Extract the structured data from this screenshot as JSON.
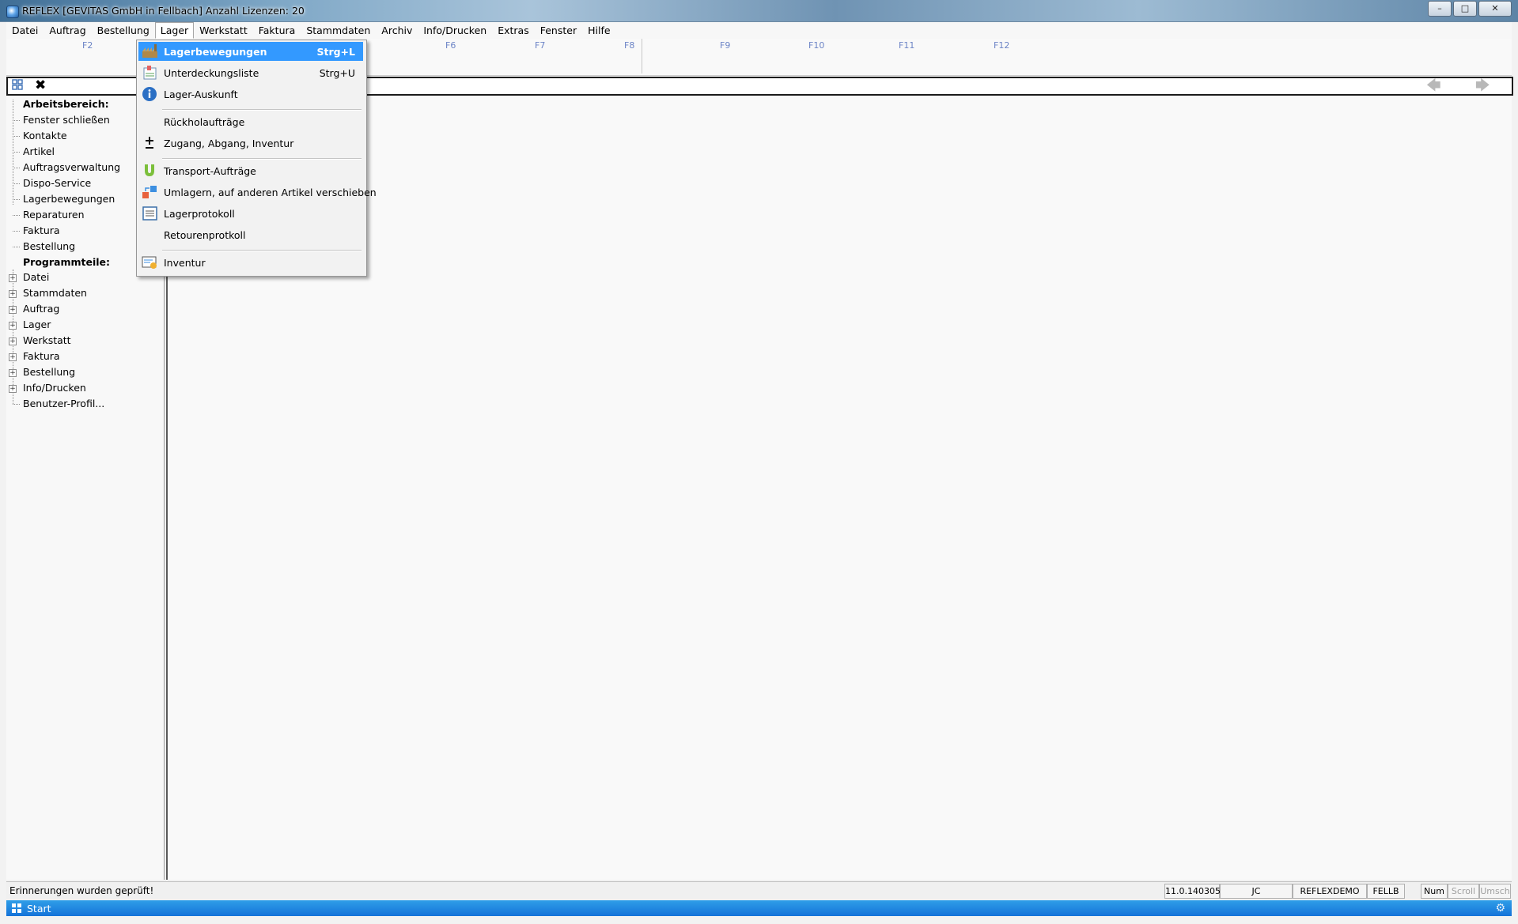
{
  "window": {
    "title": "REFLEX [GEVITAS GmbH in Fellbach] Anzahl Lizenzen: 20",
    "controls": [
      "minimize",
      "maximize",
      "close"
    ]
  },
  "menubar": {
    "items": [
      "Datei",
      "Auftrag",
      "Bestellung",
      "Lager",
      "Werkstatt",
      "Faktura",
      "Stammdaten",
      "Archiv",
      "Info/Drucken",
      "Extras",
      "Fenster",
      "Hilfe"
    ],
    "active": "Lager"
  },
  "fkeys": [
    "F2",
    "F6",
    "F7",
    "F8",
    "F9",
    "F10",
    "F11",
    "F12"
  ],
  "toolbar": {
    "icons": [
      "grid-icon",
      "close-x-icon",
      "arrow-left-icon",
      "arrow-right-icon"
    ]
  },
  "sidebar": {
    "workspace_header": "Arbeitsbereich:",
    "workspace_items": [
      "Fenster schließen",
      "Kontakte",
      "Artikel",
      "Auftragsverwaltung",
      "Dispo-Service",
      "Lagerbewegungen",
      "Reparaturen",
      "Faktura",
      "Bestellung"
    ],
    "program_header": "Programmteile:",
    "program_items": [
      "Datei",
      "Stammdaten",
      "Auftrag",
      "Lager",
      "Werkstatt",
      "Faktura",
      "Bestellung",
      "Info/Drucken"
    ],
    "last_item": "Benutzer-Profil..."
  },
  "dropdown": {
    "items": [
      {
        "label": "Lagerbewegungen",
        "shortcut": "Strg+L",
        "icon": "factory-icon",
        "highlighted": true
      },
      {
        "label": "Unterdeckungsliste",
        "shortcut": "Strg+U",
        "icon": "list-chart-icon"
      },
      {
        "label": "Lager-Auskunft",
        "shortcut": "",
        "icon": "info-icon"
      },
      {
        "label": "Rückholaufträge",
        "shortcut": "",
        "icon": ""
      },
      {
        "label": "Zugang, Abgang, Inventur",
        "shortcut": "",
        "icon": "plus-minus-icon"
      },
      {
        "label": "Transport-Aufträge",
        "shortcut": "",
        "icon": "transport-icon"
      },
      {
        "label": "Umlagern, auf anderen Artikel verschieben",
        "shortcut": "",
        "icon": "move-icon"
      },
      {
        "label": "Lagerprotokoll",
        "shortcut": "",
        "icon": "protocol-icon"
      },
      {
        "label": "Retourenprotkoll",
        "shortcut": "",
        "icon": ""
      },
      {
        "label": "Inventur",
        "shortcut": "",
        "icon": "inventory-icon"
      }
    ]
  },
  "statusbar": {
    "message": "Erinnerungen wurden geprüft!",
    "version": "11.0.140305",
    "user": "JC",
    "database": "REFLEXDEMO",
    "branch": "FELLB",
    "num": "Num",
    "scroll": "Scroll",
    "umsch": "Umsch"
  },
  "taskbar": {
    "start_label": "Start"
  },
  "colors": {
    "highlight": "#3399ff",
    "fkey_text": "#6c84c6",
    "taskbar": "#1f88e0"
  }
}
